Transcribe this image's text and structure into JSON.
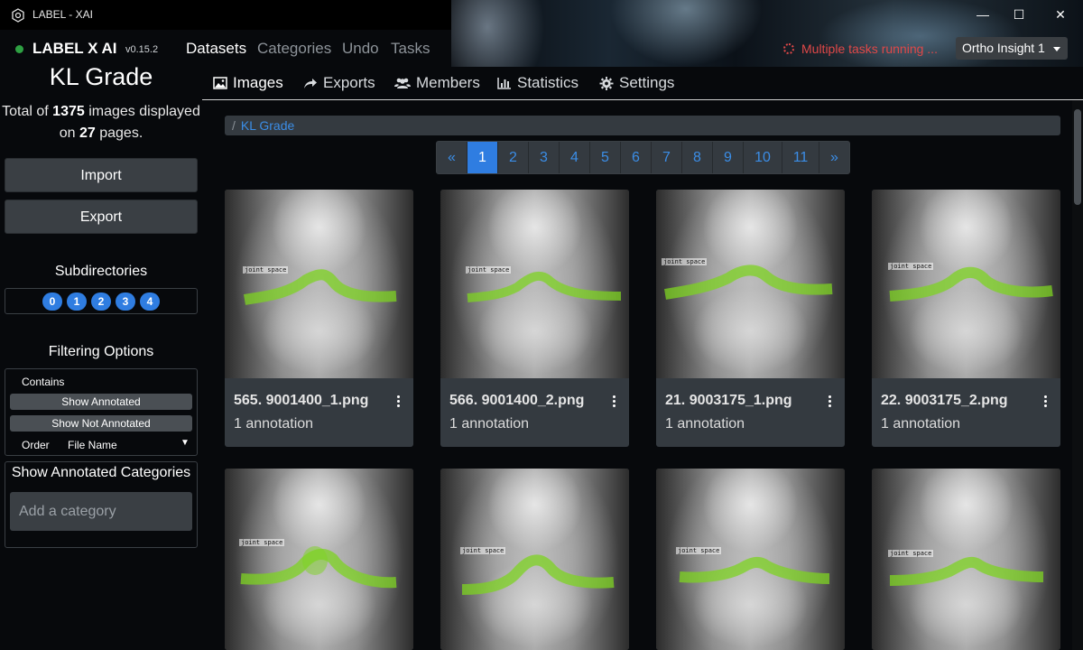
{
  "window": {
    "title": "LABEL - XAI",
    "controls": [
      "—",
      "☐",
      "✕"
    ]
  },
  "topnav": {
    "brand": "LABEL X AI",
    "version": "v0.15.2",
    "links": [
      {
        "label": "Datasets",
        "active": true
      },
      {
        "label": "Categories",
        "active": false
      },
      {
        "label": "Undo",
        "active": false
      },
      {
        "label": "Tasks",
        "active": false
      }
    ],
    "tasks_status": "Multiple tasks running ...",
    "project": "Ortho Insight 1"
  },
  "sidebar": {
    "dataset_title": "KL Grade",
    "total_prefix": "Total of ",
    "total_images": "1375",
    "total_mid": " images displayed",
    "total_on": "on ",
    "total_pages": "27",
    "total_suffix": " pages.",
    "import_label": "Import",
    "export_label": "Export",
    "subdirectories_heading": "Subdirectories",
    "subdirectories": [
      "0",
      "1",
      "2",
      "3",
      "4"
    ],
    "filtering_heading": "Filtering Options",
    "contains_label": "Contains",
    "show_annotated": "Show Annotated",
    "show_not_annotated": "Show Not Annotated",
    "order_label": "Order",
    "order_value": "File Name",
    "categories_heading": "Show Annotated Categories",
    "category_placeholder": "Add a category"
  },
  "subtabs": [
    {
      "label": "Images",
      "icon": "image-icon",
      "active": true
    },
    {
      "label": "Exports",
      "icon": "share-icon",
      "active": false
    },
    {
      "label": "Members",
      "icon": "users-icon",
      "active": false
    },
    {
      "label": "Statistics",
      "icon": "bar-chart-icon",
      "active": false
    },
    {
      "label": "Settings",
      "icon": "gear-icon",
      "active": false
    }
  ],
  "breadcrumb": {
    "separator": "/",
    "item": "KL Grade"
  },
  "pagination": {
    "prev": "«",
    "pages": [
      "1",
      "2",
      "3",
      "4",
      "5",
      "6",
      "7",
      "8",
      "9",
      "10",
      "11"
    ],
    "next": "»",
    "active": "1"
  },
  "images": [
    {
      "name": "565. 9001400_1.png",
      "annotations": "1 annotation",
      "tag": "joint space"
    },
    {
      "name": "566. 9001400_2.png",
      "annotations": "1 annotation",
      "tag": "joint space"
    },
    {
      "name": "21. 9003175_1.png",
      "annotations": "1 annotation",
      "tag": "joint space"
    },
    {
      "name": "22. 9003175_2.png",
      "annotations": "1 annotation",
      "tag": "joint space"
    },
    {
      "name": "",
      "annotations": "",
      "tag": "joint space"
    },
    {
      "name": "",
      "annotations": "",
      "tag": "joint space"
    },
    {
      "name": "",
      "annotations": "",
      "tag": "joint space"
    },
    {
      "name": "",
      "annotations": "",
      "tag": "joint space"
    }
  ],
  "colors": {
    "accent": "#2f7de1",
    "link": "#3b8de6",
    "annotation": "#7ed321",
    "status_ok": "#2ea043",
    "status_busy": "#e04848"
  }
}
